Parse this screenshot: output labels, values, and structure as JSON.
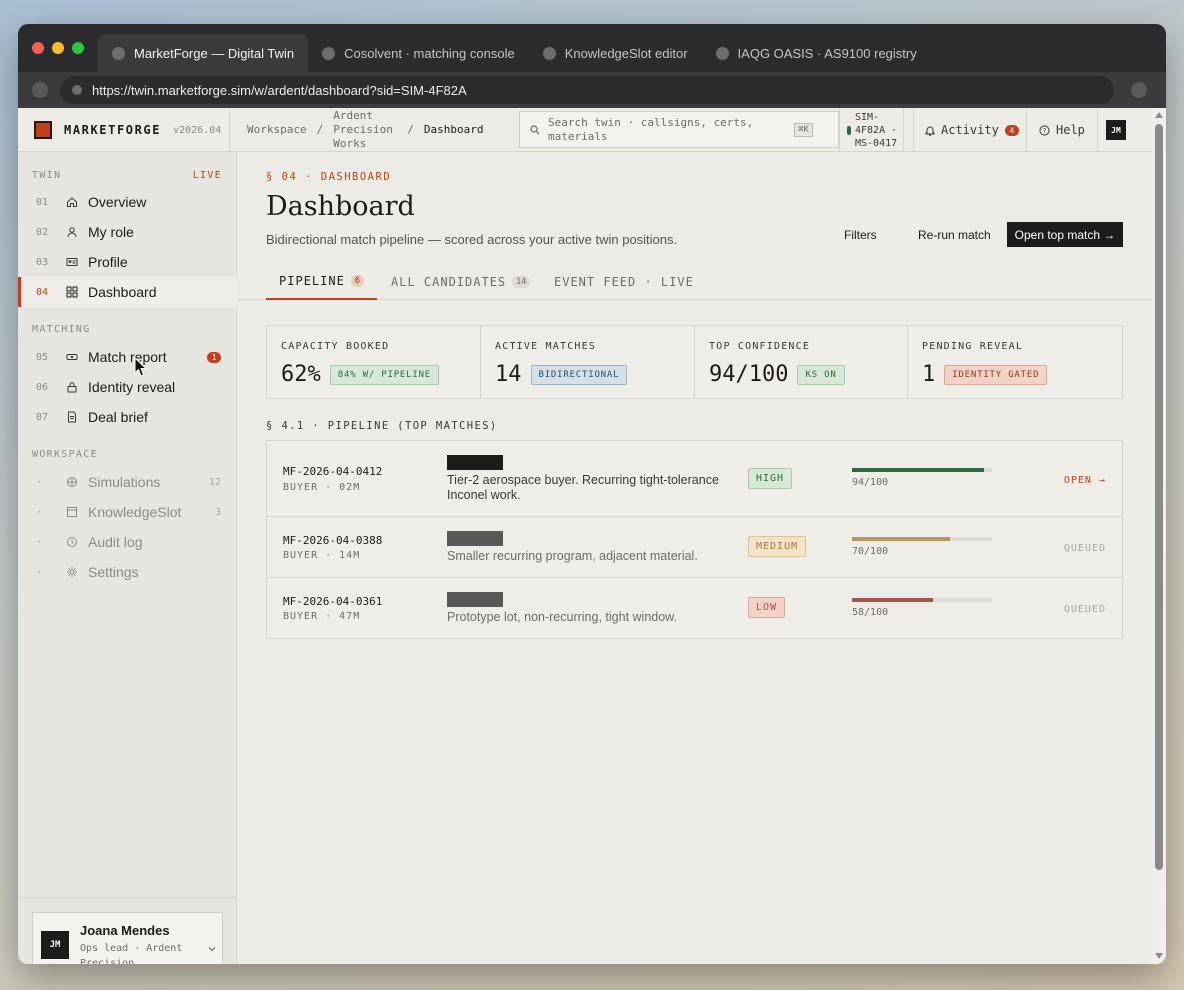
{
  "browser": {
    "tabs": [
      {
        "title": "MarketForge — Digital Twin",
        "active": true
      },
      {
        "title": "Cosolvent · matching console",
        "active": false
      },
      {
        "title": "KnowledgeSlot editor",
        "active": false
      },
      {
        "title": "IAQG OASIS · AS9100 registry",
        "active": false
      }
    ],
    "url": "https://twin.marketforge.sim/w/ardent/dashboard?sid=SIM-4F82A"
  },
  "brand": {
    "name": "MARKETFORGE",
    "version": "v2026.04",
    "accent": "#c0401a"
  },
  "breadcrumb": {
    "root": "Workspace",
    "sep": "/",
    "company": "Ardent Precision Works",
    "page": "Dashboard"
  },
  "search": {
    "placeholder": "Search twin · callsigns, certs, materials",
    "shortcut": "⌘K"
  },
  "session": {
    "text": "SIM-4F82A · MS-0417"
  },
  "topbar": {
    "activity_label": "Activity",
    "activity_count": "4",
    "help_label": "Help",
    "avatar": "JM"
  },
  "sidebar": {
    "twin_label": "TWIN",
    "live_label": "LIVE",
    "twin_items": [
      {
        "num": "01",
        "label": "Overview",
        "icon": "home-icon"
      },
      {
        "num": "02",
        "label": "My role",
        "icon": "user-icon"
      },
      {
        "num": "03",
        "label": "Profile",
        "icon": "id-card-icon"
      },
      {
        "num": "04",
        "label": "Dashboard",
        "icon": "grid-icon"
      }
    ],
    "matching_label": "MATCHING",
    "matching_items": [
      {
        "num": "05",
        "label": "Match report",
        "badge": "1",
        "icon": "ticket-icon"
      },
      {
        "num": "06",
        "label": "Identity reveal",
        "icon": "lock-icon"
      },
      {
        "num": "07",
        "label": "Deal brief",
        "icon": "document-icon"
      }
    ],
    "workspace_label": "WORKSPACE",
    "workspace_items": [
      {
        "num": "·",
        "label": "Simulations",
        "count": "12",
        "icon": "globe-icon"
      },
      {
        "num": "·",
        "label": "KnowledgeSlot",
        "count": "3",
        "icon": "square-icon"
      },
      {
        "num": "·",
        "label": "Audit log",
        "icon": "clock-icon"
      },
      {
        "num": "·",
        "label": "Settings",
        "icon": "gear-icon"
      }
    ],
    "user": {
      "initials": "JM",
      "name": "Joana Mendes",
      "role": "Ops lead · Ardent Precision"
    }
  },
  "page": {
    "eyebrow": "§ 04 · DASHBOARD",
    "title": "Dashboard",
    "subtitle": "Bidirectional match pipeline — scored across your active twin positions.",
    "actions": {
      "filters": "Filters",
      "rerun": "Re-run match",
      "open_top": "Open top match →"
    }
  },
  "tabs": [
    {
      "label": "PIPELINE",
      "count": "6",
      "active": true
    },
    {
      "label": "ALL CANDIDATES",
      "count": "14",
      "active": false
    },
    {
      "label": "EVENT FEED · LIVE",
      "active": false
    }
  ],
  "kpis": [
    {
      "label": "CAPACITY BOOKED",
      "value": "62%",
      "pill": "84% W/ PIPELINE",
      "tone": "green"
    },
    {
      "label": "ACTIVE MATCHES",
      "value": "14",
      "pill": "BIDIRECTIONAL",
      "tone": "blue"
    },
    {
      "label": "TOP CONFIDENCE",
      "value": "94/100",
      "pill": "KS ON",
      "tone": "green"
    },
    {
      "label": "PENDING REVEAL",
      "value": "1",
      "pill": "IDENTITY GATED",
      "tone": "red"
    }
  ],
  "pipeline": {
    "heading": "§ 4.1 · PIPELINE (TOP MATCHES)",
    "rows": [
      {
        "id": "MF-2026-04-0412",
        "sub": "BUYER · 02M",
        "desc": "Tier-2 aerospace buyer. Recurring tight-tolerance Inconel work.",
        "confidence": "HIGH",
        "score_text": "94/100",
        "score": 94,
        "action": "OPEN →",
        "fill_color": "#2d6a44"
      },
      {
        "id": "MF-2026-04-0388",
        "sub": "BUYER · 14M",
        "desc": "Smaller recurring program, adjacent material.",
        "confidence": "MEDIUM",
        "score_text": "70/100",
        "score": 70,
        "action": "QUEUED",
        "fill_color": "#c0945a"
      },
      {
        "id": "MF-2026-04-0361",
        "sub": "BUYER · 47M",
        "desc": "Prototype lot, non-recurring, tight window.",
        "confidence": "LOW",
        "score_text": "58/100",
        "score": 58,
        "action": "QUEUED",
        "fill_color": "#a8564a"
      }
    ]
  }
}
